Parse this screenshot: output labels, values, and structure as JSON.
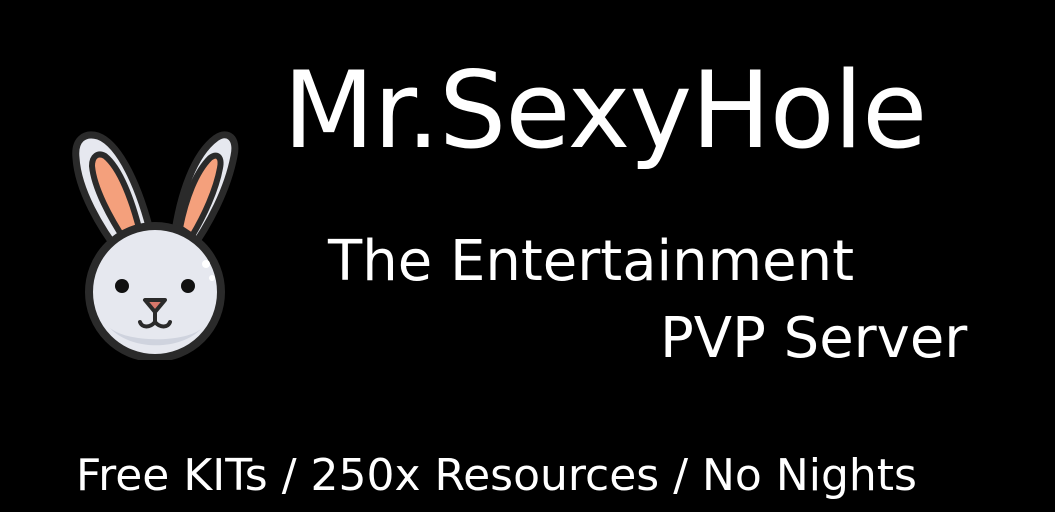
{
  "banner": {
    "title": "Mr.SexyHole",
    "subtitle_line1": "The Entertainment",
    "subtitle_line2": "PVP Server",
    "features": "Free KITs / 250x Resources / No Nights"
  },
  "logo": {
    "icon": "rabbit-icon"
  },
  "colors": {
    "background": "#000000",
    "text": "#ffffff",
    "rabbit_fur": "#e6e8ef",
    "rabbit_fur_shade": "#cfd3de",
    "rabbit_outline": "#2a2a2a",
    "rabbit_inner_ear": "#f4a07c",
    "rabbit_nose": "#d9776a"
  }
}
